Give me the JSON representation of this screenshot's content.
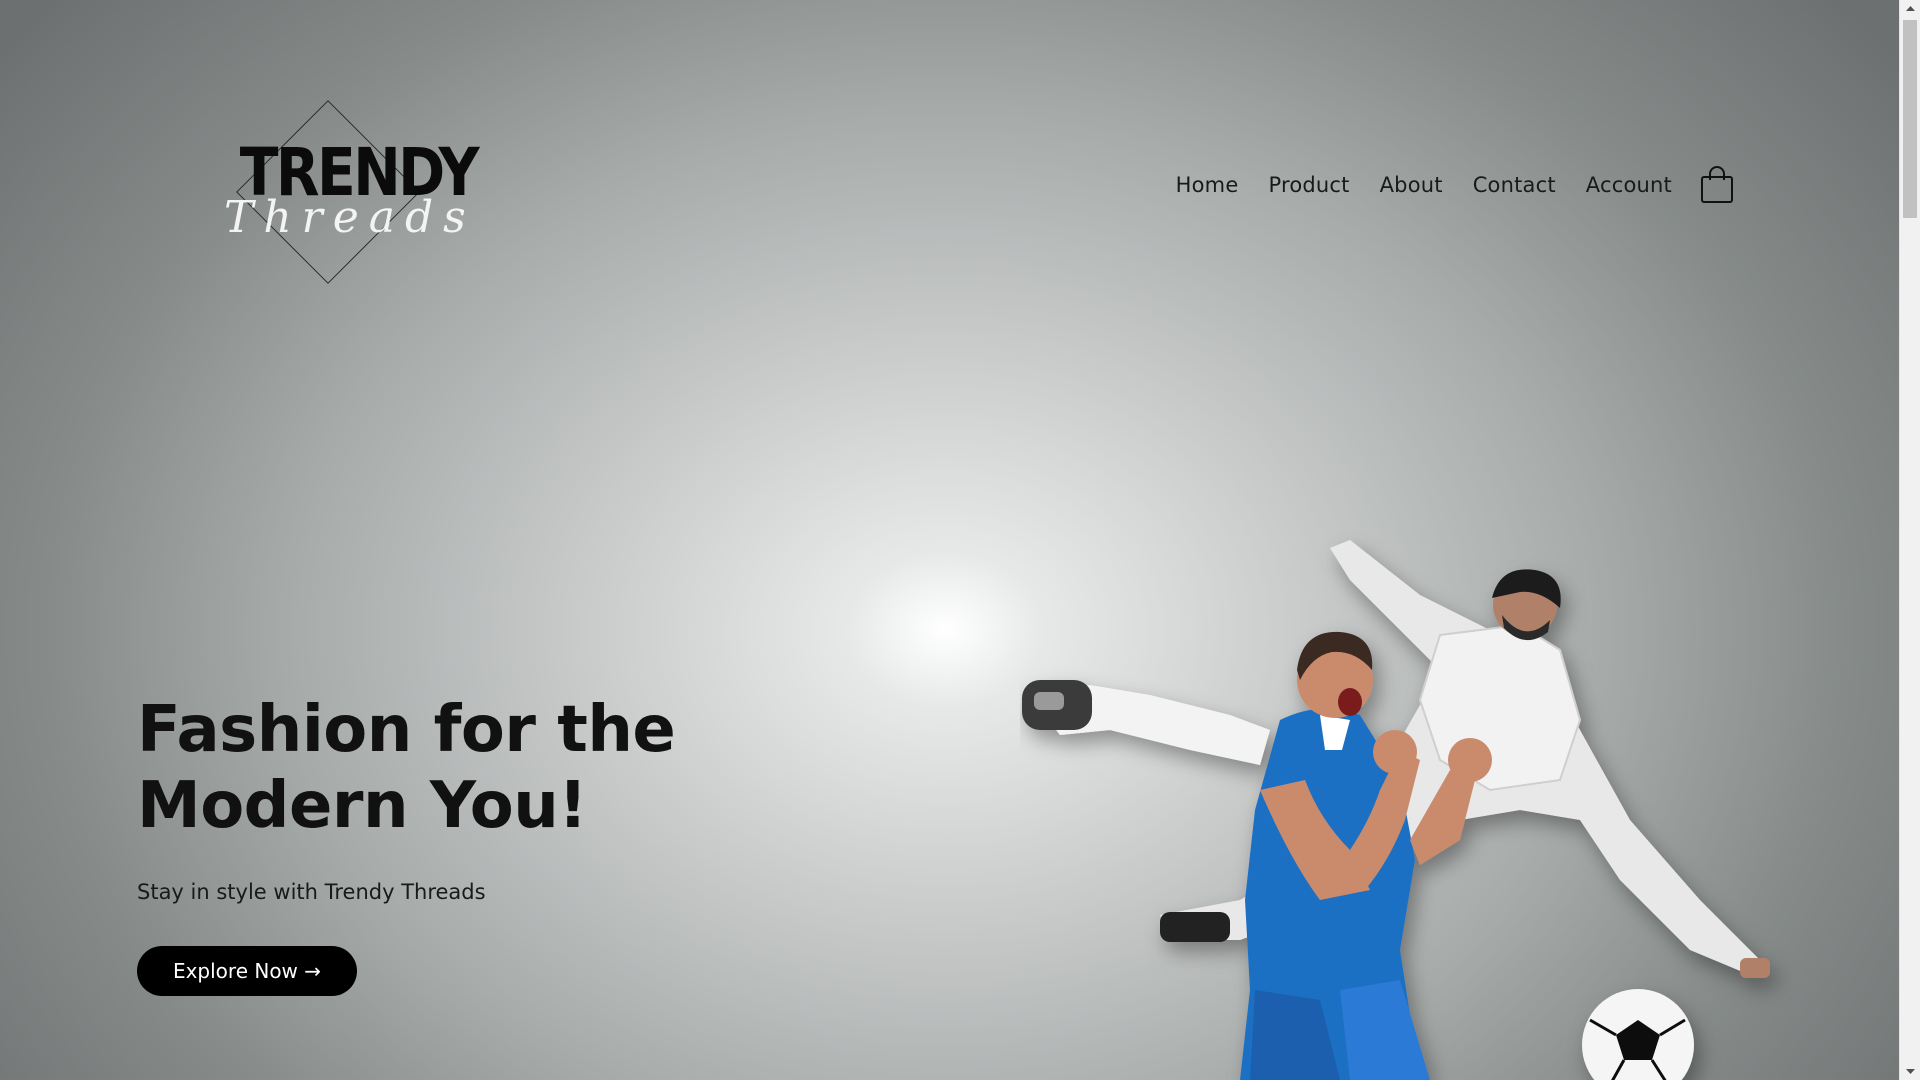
{
  "logo": {
    "word": "TRENDY",
    "script": "Threads"
  },
  "nav": {
    "items": [
      "Home",
      "Product",
      "About",
      "Contact",
      "Account"
    ],
    "cart_icon": "shopping-bag-icon"
  },
  "hero": {
    "title": "Fashion for the Modern You!",
    "subtitle": "Stay in style with Trendy Threads",
    "cta_label": "Explore Now →"
  },
  "colors": {
    "text": "#111111",
    "button_bg": "#000000",
    "button_text": "#ffffff",
    "jersey_blue": "#1f6fc4"
  }
}
